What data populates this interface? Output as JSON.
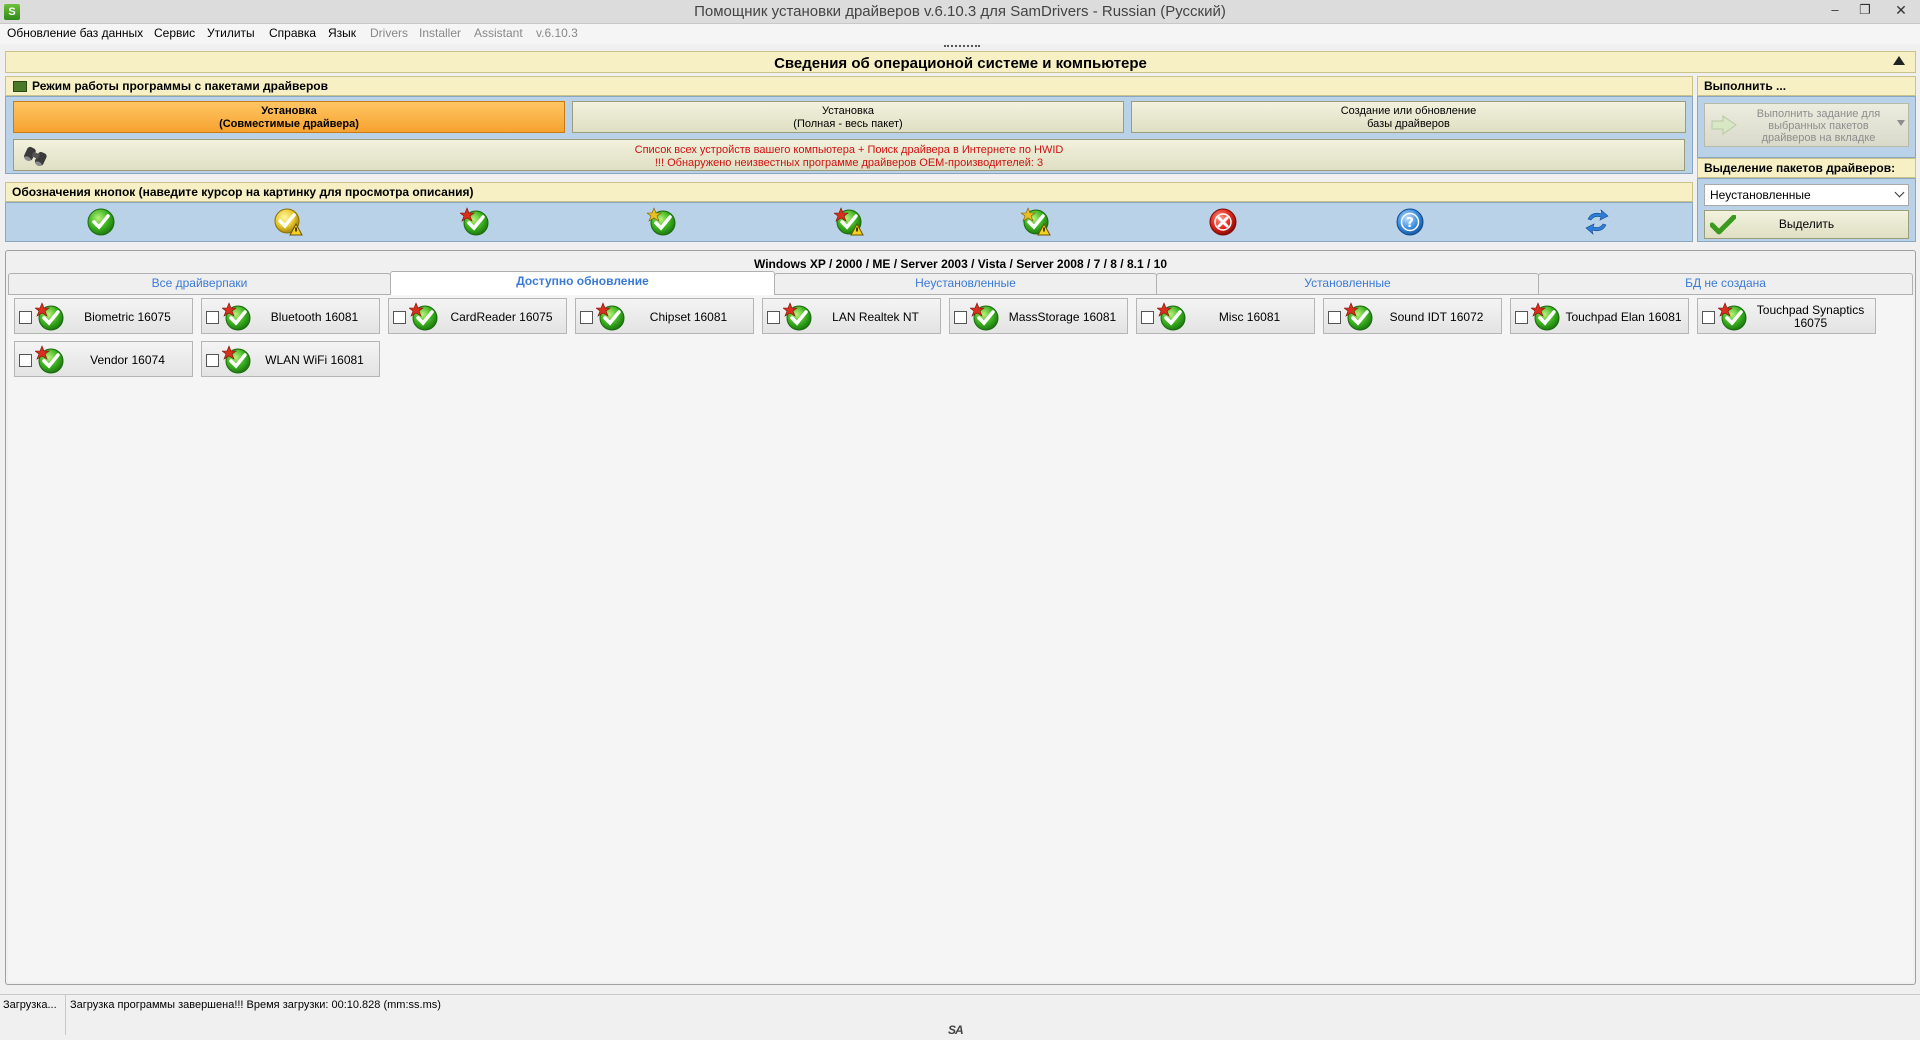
{
  "window": {
    "title": "Помощник установки драйверов v.6.10.3 для SamDrivers - Russian (Русский)",
    "app_icon_letter": "S"
  },
  "menu": {
    "items": [
      "Обновление баз данных",
      "Сервис",
      "Утилиты",
      "Справка",
      "Язык"
    ],
    "dim_items": [
      "Drivers",
      "Installer",
      "Assistant",
      "v.6.10.3"
    ]
  },
  "section": {
    "title": "Сведения об операционой системе и компьютере"
  },
  "mode": {
    "heading": "Режим работы программы с пакетами драйверов",
    "buttons": [
      {
        "line1": "Установка",
        "line2": "(Совместимые драйвера)",
        "active": true
      },
      {
        "line1": "Установка",
        "line2": "(Полная - весь пакет)",
        "active": false
      },
      {
        "line1": "Создание или обновление",
        "line2": "базы драйверов",
        "active": false
      }
    ],
    "hwid_line1": "Список всех устройств вашего компьютера + Поиск драйвера в Интернете по HWID",
    "hwid_line2": "!!! Обнаружено неизвестных программе драйверов OEM-производителей: 3"
  },
  "legend": {
    "heading": "Обозначения кнопок (наведите курсор на картинку для просмотра описания)",
    "icons": [
      "green-check-icon",
      "yellow-check-warning-icon",
      "star-green-check-icon",
      "star-green-check-icon",
      "star-check-warning-icon",
      "star-check-warning-icon",
      "red-cross-icon",
      "blue-question-icon",
      "blue-refresh-arrows-icon"
    ]
  },
  "execute": {
    "heading": "Выполнить ...",
    "button_text": "Выполнить задание для выбранных пакетов драйверов на вкладке"
  },
  "selection": {
    "heading": "Выделение пакетов драйверов:",
    "combo_value": "Неустановленные",
    "select_button": "Выделить"
  },
  "os_line": "Windows XP / 2000 / ME / Server 2003 / Vista / Server 2008 / 7 / 8 / 8.1 / 10",
  "tabs": [
    {
      "label": "Все драйверпаки",
      "active": false
    },
    {
      "label": "Доступно обновление",
      "active": true
    },
    {
      "label": "Неустановленные",
      "active": false
    },
    {
      "label": "Установленные",
      "active": false
    },
    {
      "label": "БД не создана",
      "active": false
    }
  ],
  "packages": [
    "Biometric 16075",
    "Bluetooth 16081",
    "CardReader 16075",
    "Chipset 16081",
    "LAN Realtek NT",
    "MassStorage 16081",
    "Misc 16081",
    "Sound IDT 16072",
    "Touchpad Elan 16081",
    "Touchpad Synaptics 16075",
    "Vendor 16074",
    "WLAN WiFi 16081"
  ],
  "status": {
    "left": "Загрузка...",
    "message": "Загрузка программы завершена!!! Время загрузки: 00:10.828 (mm:ss.ms)",
    "logo": "SA"
  },
  "colors": {
    "accent_orange": "#f6a22f",
    "panel_blue": "#b9d2e8",
    "panel_yellow": "#f6f0c4",
    "tab_text": "#3a7ad6",
    "warning_text": "#d01010"
  }
}
